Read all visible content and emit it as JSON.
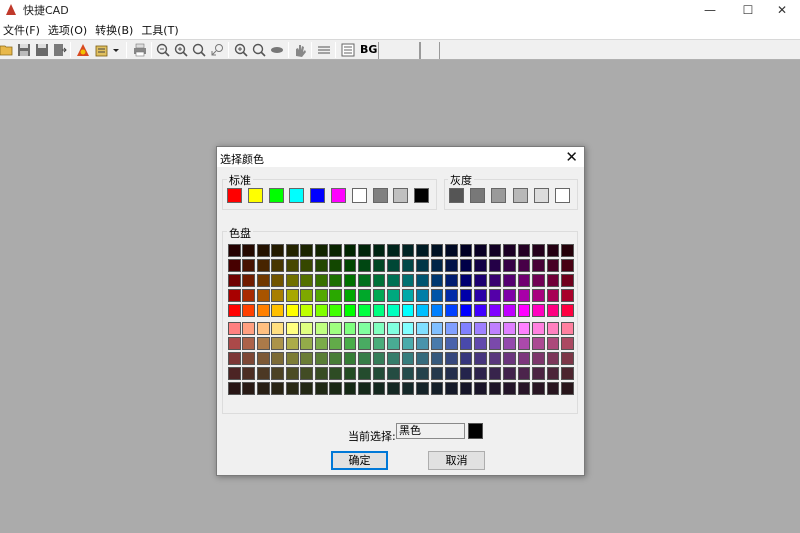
{
  "app": {
    "title": "快捷CAD"
  },
  "window_controls": {
    "minimize": "—",
    "maximize": "☐",
    "close": "✕"
  },
  "menu": [
    {
      "label": "文件(F)"
    },
    {
      "label": "选项(O)"
    },
    {
      "label": "转换(B)"
    },
    {
      "label": "工具(T)"
    }
  ],
  "toolbar": {
    "bg_label": "BG"
  },
  "dialog": {
    "title": "选择颜色",
    "close": "✕",
    "standard": {
      "label": "标准",
      "colors": [
        "#ff0000",
        "#ffff00",
        "#00ff00",
        "#00ffff",
        "#0000ff",
        "#ff00ff",
        "#ffffff",
        "#808080",
        "#c0c0c0",
        "#000000"
      ]
    },
    "gray": {
      "label": "灰度",
      "colors": [
        "#555555",
        "#787878",
        "#9a9a9a",
        "#b8b8b8",
        "#dcdcdc",
        "#ffffff"
      ]
    },
    "palette": {
      "label": "色盘"
    },
    "current": {
      "label": "当前选择:",
      "value": "黑色",
      "color": "#000000"
    },
    "ok_label": "确定",
    "cancel_label": "取消"
  }
}
